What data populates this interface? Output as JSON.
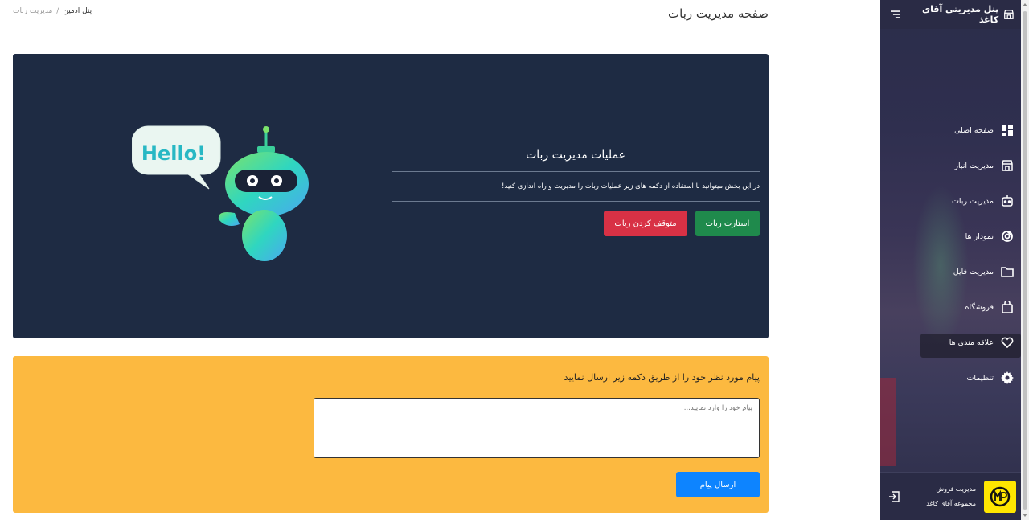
{
  "app": {
    "brand": "پنل مدیریتی آقای کاغذ"
  },
  "sidebar": {
    "items": [
      {
        "label": "صفحه اصلی",
        "icon": "dashboard-icon"
      },
      {
        "label": "مدیریت انبار",
        "icon": "store-icon"
      },
      {
        "label": "مدیریت ربات",
        "icon": "robot-icon"
      },
      {
        "label": "نمودار ها",
        "icon": "chart-icon"
      },
      {
        "label": "مدیریت فایل",
        "icon": "folder-icon"
      },
      {
        "label": "فروشگاه",
        "icon": "shopping-bag-icon"
      },
      {
        "label": "علاقه مندی ها",
        "icon": "heart-icon"
      },
      {
        "label": "تنظیمات",
        "icon": "gear-icon"
      }
    ],
    "user": {
      "role": "مدیریت فروش",
      "org": "مجموعه آقای کاغذ"
    }
  },
  "header": {
    "title": "صفحه مدیریت ربات",
    "breadcrumb": {
      "home": "پنل ادمین",
      "separator": "/",
      "current": "مدیریت ربات"
    }
  },
  "robot_ops": {
    "title": "عملیات مدیریت ربات",
    "description": "در این بخش میتوانید با استفاده از دکمه های زیر عملیات ربات را مدیریت و راه اندازی کنید!",
    "start_label": "استارت ربات",
    "stop_label": "متوقف کردن ربات",
    "illustration_text": "Hello!"
  },
  "message": {
    "title": "پیام مورد نظر خود را از طریق دکمه زیر ارسال نمایید",
    "placeholder": "پیام خود را وارد نمایید...",
    "send_label": "ارسال پیام"
  },
  "colors": {
    "sidebar": "#2b2d4a",
    "card_dark": "#1e2b43",
    "card_warning": "#fcb940",
    "success": "#1f8a4c",
    "danger": "#d83145",
    "primary": "#0d84ff"
  }
}
